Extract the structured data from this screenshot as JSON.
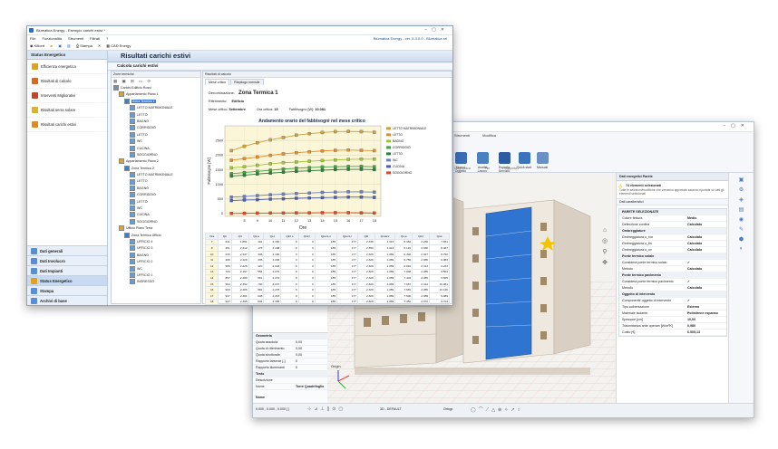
{
  "back_window": {
    "ribbon_tabs": [
      "Strumenti",
      "Modifica"
    ],
    "ribbon_buttons": [
      {
        "label": "Nuovo Oggetto",
        "color": "#3a6fb5"
      },
      {
        "label": "Analisi Lavoro",
        "color": "#4a7fc0"
      },
      {
        "label": "Esporta Servizio",
        "color": "#2d5da0"
      },
      {
        "label": "Quick start",
        "color": "#3b74bd"
      },
      {
        "label": "Manuali",
        "color": "#6a8fc4"
      }
    ],
    "ribbon_groups": [
      "Diagnostica",
      "File",
      "Supporto"
    ],
    "left_tree": [
      "Locali",
      "Posizionamenti"
    ],
    "props_title": "Dati energetici Parete",
    "selected_note": "74 elementi selezionati",
    "hint_text": "Tutte le selezioni/modifiche che verranno apportate saranno riportate su tutti gli elementi selezionati",
    "dati_label": "Dati caratteristici",
    "props_group": "PARETE SELEZIONATE",
    "props_rows": [
      {
        "k": "Colore finitura",
        "v": "Medio",
        "grp": false
      },
      {
        "k": "Definizione confine",
        "v": "Calcolato",
        "grp": false
      },
      {
        "k": "Ombreggiature",
        "v": "",
        "grp": true
      },
      {
        "k": "Ombreggiatura o_hor",
        "v": "Calcolato",
        "grp": false
      },
      {
        "k": "Ombreggiatura o_fin",
        "v": "Calcolato",
        "grp": false
      },
      {
        "k": "Ombreggiatura o_ov",
        "v": "Calcolato",
        "grp": false
      },
      {
        "k": "Ponte termico solaio",
        "v": "",
        "grp": true
      },
      {
        "k": "Considera ponte termico solaio",
        "v": "✓",
        "grp": false
      },
      {
        "k": "Metodo",
        "v": "Calcolato",
        "grp": false
      },
      {
        "k": "Ponte termico pavimento",
        "v": "",
        "grp": true
      },
      {
        "k": "Considera ponte termico pavimento",
        "v": "✓",
        "grp": false
      },
      {
        "k": "Metodo",
        "v": "Calcolato",
        "grp": false
      },
      {
        "k": "Oggetto di intervento",
        "v": "",
        "grp": true
      },
      {
        "k": "Componente oggetto di intervento",
        "v": "✓",
        "grp": false
      },
      {
        "k": "Tipo coibentazione",
        "v": "Esterna",
        "grp": false
      },
      {
        "k": "Materiale isolante",
        "v": "Polistirene espanso",
        "grp": false
      },
      {
        "k": "Spessore [cm]",
        "v": "10,00",
        "grp": false
      },
      {
        "k": "Trasmittanza ante operam [W/m²K]",
        "v": "0,980",
        "grp": false
      },
      {
        "k": "Costo [€]",
        "v": "6.505,13",
        "grp": false
      }
    ],
    "geometry_title": "Geometria",
    "geometry_rows": [
      {
        "k": "Quota assoluta",
        "v": "0,00"
      },
      {
        "k": "Quota di riferimento",
        "v": "0,00"
      },
      {
        "k": "Quota strutturale",
        "v": "0,00"
      },
      {
        "k": "Rapporto larsenie [-]",
        "v": "0"
      },
      {
        "k": "Rapporto illuminanti",
        "v": "0"
      }
    ],
    "testo_title": "Testo",
    "testo_rows": [
      {
        "k": "Descrizione",
        "v": ""
      },
      {
        "k": "Nome",
        "v": "Torre Quadrifoglio"
      }
    ],
    "name_label": "Nome",
    "status_text": "0.000 , 0.000 , 0.000 [  ]",
    "status_layer": "3D - DEFAULT",
    "status_ortho": "Ortogr.",
    "axis_label": "Origin"
  },
  "front_window": {
    "title": "Blumatica Energy - Esempio carichi estivi *",
    "menu": [
      "File",
      "Funzionalità",
      "Strumenti",
      "Filtrati",
      "?"
    ],
    "toolbar": [
      "Kitbert",
      "Stampa",
      "CAD Energy"
    ],
    "version": "Blumatica Energy - ver. 8.3.0.0 - Blumatica srl",
    "nav_header": "Status Energetico",
    "nav_items": [
      {
        "label": "Efficienza energetica",
        "color": "#e0a020"
      },
      {
        "label": "Risultati di calcolo",
        "color": "#d46a1c"
      },
      {
        "label": "Interventi Migliorativi",
        "color": "#c2452a"
      },
      {
        "label": "Risultati serra solare",
        "color": "#e0b02a"
      },
      {
        "label": "Risultati carichi estivi",
        "color": "#e28a1f"
      }
    ],
    "nav_bottom": [
      {
        "label": "Dati generali",
        "selected": false
      },
      {
        "label": "Dati Involucro",
        "selected": false
      },
      {
        "label": "Dati Impianti",
        "selected": false
      },
      {
        "label": "Status Energetico",
        "selected": true
      },
      {
        "label": "Stampa",
        "selected": false
      },
      {
        "label": "Archivi di base",
        "selected": false
      }
    ],
    "main_title": "Risultati carichi estivi",
    "sub_title": "Calcola carichi estivi",
    "tree_header": "Zone termiche",
    "tree": [
      {
        "indent": 0,
        "label": "Carichi Edificio Rossi"
      },
      {
        "indent": 1,
        "label": "Appartamento Piano 1"
      },
      {
        "indent": 2,
        "label": "Zona Termica 1",
        "selected": true
      },
      {
        "indent": 3,
        "label": "LETTO MATRIMONIALE"
      },
      {
        "indent": 3,
        "label": "LETTO"
      },
      {
        "indent": 3,
        "label": "BAGNO"
      },
      {
        "indent": 3,
        "label": "CORRIDOIO"
      },
      {
        "indent": 3,
        "label": "LETTO"
      },
      {
        "indent": 3,
        "label": "WC"
      },
      {
        "indent": 3,
        "label": "CUCINA"
      },
      {
        "indent": 3,
        "label": "SOGGIORNO"
      },
      {
        "indent": 1,
        "label": "Appartamento Piano 2"
      },
      {
        "indent": 2,
        "label": "Zona Termica 2"
      },
      {
        "indent": 3,
        "label": "LETTO MATRIMONIALE"
      },
      {
        "indent": 3,
        "label": "LETTO"
      },
      {
        "indent": 3,
        "label": "BAGNO"
      },
      {
        "indent": 3,
        "label": "CORRIDOIO"
      },
      {
        "indent": 3,
        "label": "LETTO"
      },
      {
        "indent": 3,
        "label": "WC"
      },
      {
        "indent": 3,
        "label": "CUCINA"
      },
      {
        "indent": 3,
        "label": "SOGGIORNO"
      },
      {
        "indent": 1,
        "label": "Ufficio Piano Terra"
      },
      {
        "indent": 2,
        "label": "Zona Termica Ufficio"
      },
      {
        "indent": 3,
        "label": "UFFICIO 4"
      },
      {
        "indent": 3,
        "label": "UFFICIO 3"
      },
      {
        "indent": 3,
        "label": "BAGNO"
      },
      {
        "indent": 3,
        "label": "UFFICIO 2"
      },
      {
        "indent": 3,
        "label": "WC"
      },
      {
        "indent": 3,
        "label": "UFFICIO 1"
      },
      {
        "indent": 3,
        "label": "INGRESSO"
      }
    ],
    "result_header": "Risultati di calcolo",
    "tabs": [
      "Mese critico",
      "Riepilogo mensile"
    ],
    "denominazione_label": "Denominazione:",
    "denominazione_value": "Zona Termica 1",
    "riferimento_label": "Riferimento:",
    "riferimento_value": "Edificio",
    "mese_label": "Mese critico:",
    "mese_value": "Settembre",
    "ora_label": "Ora critica:",
    "ora_value": "15",
    "fabb_label": "Fabbisogno [W]:",
    "fabb_value": "10.081",
    "table_headers": [
      "Ora",
      "Qtr",
      "Qlt",
      "Qs,a",
      "Qs,l",
      "Qinf,s",
      "Qinf,l",
      "Qpers,s",
      "Qpers,l",
      "Qill",
      "Qmacc",
      "Qs,a",
      "Qd,l",
      "Qtot"
    ],
    "table_rows": [
      [
        "7",
        "641",
        "1.891",
        "101",
        "2.160",
        "0",
        "0",
        "185",
        "177",
        "2.339",
        "1.013",
        "6.384",
        "2.236",
        "7.931"
      ],
      [
        "8",
        "261",
        "2.212",
        "178",
        "2.168",
        "0",
        "0",
        "185",
        "177",
        "2.350",
        "1.013",
        "6.191",
        "2.336",
        "8.467"
      ],
      [
        "10",
        "233",
        "2.347",
        "346",
        "2.190",
        "0",
        "0",
        "185",
        "177",
        "2.329",
        "1.069",
        "6.492",
        "2.327",
        "8.792"
      ],
      [
        "11",
        "466",
        "2.220",
        "335",
        "2.206",
        "0",
        "0",
        "185",
        "177",
        "2.329",
        "1.089",
        "6.755",
        "2.365",
        "9.083"
      ],
      [
        "12",
        "586",
        "2.226",
        "420",
        "2.226",
        "0",
        "0",
        "185",
        "177",
        "2.329",
        "1.089",
        "6.810",
        "2.413",
        "9.223"
      ],
      [
        "13",
        "720",
        "2.167",
        "556",
        "2.270",
        "0",
        "0",
        "185",
        "177",
        "2.329",
        "1.089",
        "7.048",
        "2.455",
        "9.504"
      ],
      [
        "14",
        "857",
        "2.280",
        "661",
        "2.270",
        "0",
        "0",
        "185",
        "177",
        "2.329",
        "1.089",
        "7.402",
        "2.455",
        "9.605"
      ],
      [
        "15",
        "964",
        "2.362",
        "730",
        "2.237",
        "0",
        "0",
        "185",
        "177",
        "2.329",
        "1.089",
        "7.667",
        "2.414",
        "10.081"
      ],
      [
        "16",
        "960",
        "2.406",
        "682",
        "2.278",
        "0",
        "0",
        "185",
        "177",
        "2.329",
        "1.089",
        "7.681",
        "2.455",
        "10.136"
      ],
      [
        "17",
        "947",
        "2.401",
        "648",
        "2.213",
        "0",
        "0",
        "185",
        "177",
        "2.329",
        "1.089",
        "7.600",
        "2.389",
        "9.989"
      ],
      [
        "18",
        "927",
        "2.395",
        "636",
        "2.305",
        "0",
        "0",
        "185",
        "177",
        "2.329",
        "1.089",
        "7.452",
        "2.372",
        "9.723"
      ]
    ]
  },
  "chart_data": {
    "type": "line",
    "title": "Andamento orario del fabbisogni nel mese critico",
    "xlabel": "Ore",
    "ylabel": "Fabbisogno [W]",
    "x": [
      7,
      8,
      9,
      10,
      11,
      12,
      13,
      14,
      15,
      16,
      17,
      18
    ],
    "xticks": [
      8,
      9,
      10,
      11,
      12,
      13,
      14,
      15,
      16,
      17,
      18
    ],
    "ylim": [
      -100,
      3000
    ],
    "yticks": [
      0,
      500,
      1000,
      1500,
      2000,
      2500
    ],
    "grid": true,
    "legend_position": "right",
    "series": [
      {
        "name": "LETTO MATRIMONIALE",
        "color": "#c8a040",
        "values": [
          2150,
          2300,
          2420,
          2520,
          2600,
          2680,
          2730,
          2770,
          2800,
          2810,
          2800,
          2780
        ]
      },
      {
        "name": "LETTO",
        "color": "#e38c2a",
        "values": [
          1820,
          1880,
          1930,
          1990,
          2040,
          2080,
          2110,
          2140,
          2160,
          2170,
          2160,
          2150
        ]
      },
      {
        "name": "BAGNO",
        "color": "#9fc23a",
        "values": [
          1560,
          1600,
          1650,
          1700,
          1740,
          1760,
          1790,
          1810,
          1830,
          1850,
          1860,
          1860
        ]
      },
      {
        "name": "CORRIDOIO",
        "color": "#44a045",
        "values": [
          1360,
          1400,
          1440,
          1480,
          1520,
          1550,
          1570,
          1590,
          1600,
          1610,
          1610,
          1600
        ]
      },
      {
        "name": "LETTO",
        "color": "#2c7f3a",
        "values": [
          1280,
          1310,
          1350,
          1380,
          1410,
          1440,
          1460,
          1480,
          1500,
          1510,
          1510,
          1500
        ]
      },
      {
        "name": "WC",
        "color": "#6b7ec0",
        "values": [
          560,
          580,
          610,
          640,
          660,
          680,
          700,
          720,
          730,
          740,
          740,
          730
        ]
      },
      {
        "name": "CUCINA",
        "color": "#4e5db0",
        "values": [
          440,
          460,
          470,
          490,
          500,
          520,
          530,
          540,
          550,
          560,
          560,
          550
        ]
      },
      {
        "name": "SOGGIORNO",
        "color": "#d94a2a",
        "values": [
          0,
          5,
          10,
          15,
          15,
          20,
          20,
          25,
          25,
          25,
          20,
          15
        ]
      }
    ]
  }
}
